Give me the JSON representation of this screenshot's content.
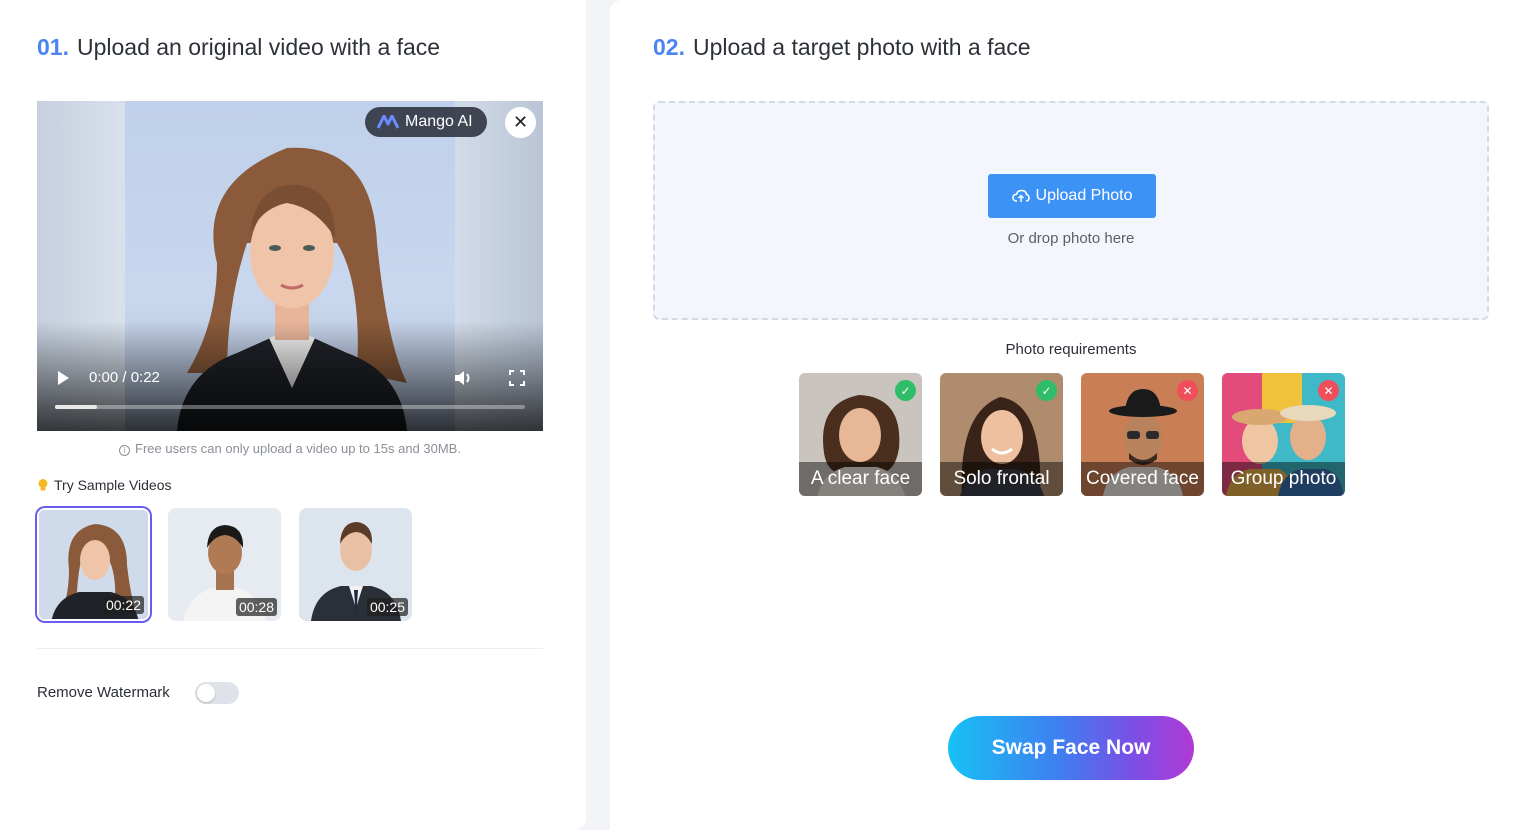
{
  "left": {
    "step_num": "01.",
    "step_title": "Upload an original video with a face",
    "video": {
      "brand": "Mango AI",
      "current_time": "0:00",
      "duration": "0:22",
      "time_display": "0:00 / 0:22",
      "progress": 0.09
    },
    "note": "Free users can only upload a video up to 15s and 30MB.",
    "samples_label": "Try Sample Videos",
    "samples": [
      {
        "duration": "00:22",
        "selected": true
      },
      {
        "duration": "00:28",
        "selected": false
      },
      {
        "duration": "00:25",
        "selected": false
      }
    ],
    "watermark_label": "Remove Watermark",
    "watermark_enabled": false
  },
  "right": {
    "step_num": "02.",
    "step_title": "Upload a target photo with a face",
    "upload_label": "Upload Photo",
    "drop_text": "Or drop photo here",
    "requirements_title": "Photo requirements",
    "requirements": [
      {
        "label": "A clear face",
        "ok": true
      },
      {
        "label": "Solo frontal",
        "ok": true
      },
      {
        "label": "Covered face",
        "ok": false
      },
      {
        "label": "Group photo",
        "ok": false
      }
    ],
    "swap_label": "Swap Face Now"
  },
  "icons": [
    "mango-logo-icon",
    "close-icon",
    "play-icon",
    "volume-icon",
    "fullscreen-icon",
    "info-icon",
    "bulb-icon",
    "cloud-upload-icon",
    "check-icon",
    "cross-icon"
  ],
  "colors": {
    "accent": "#4d84f3",
    "upload_button": "#3d93f5",
    "ok_badge": "#2fbd6a",
    "bad_badge": "#f04e5a"
  }
}
